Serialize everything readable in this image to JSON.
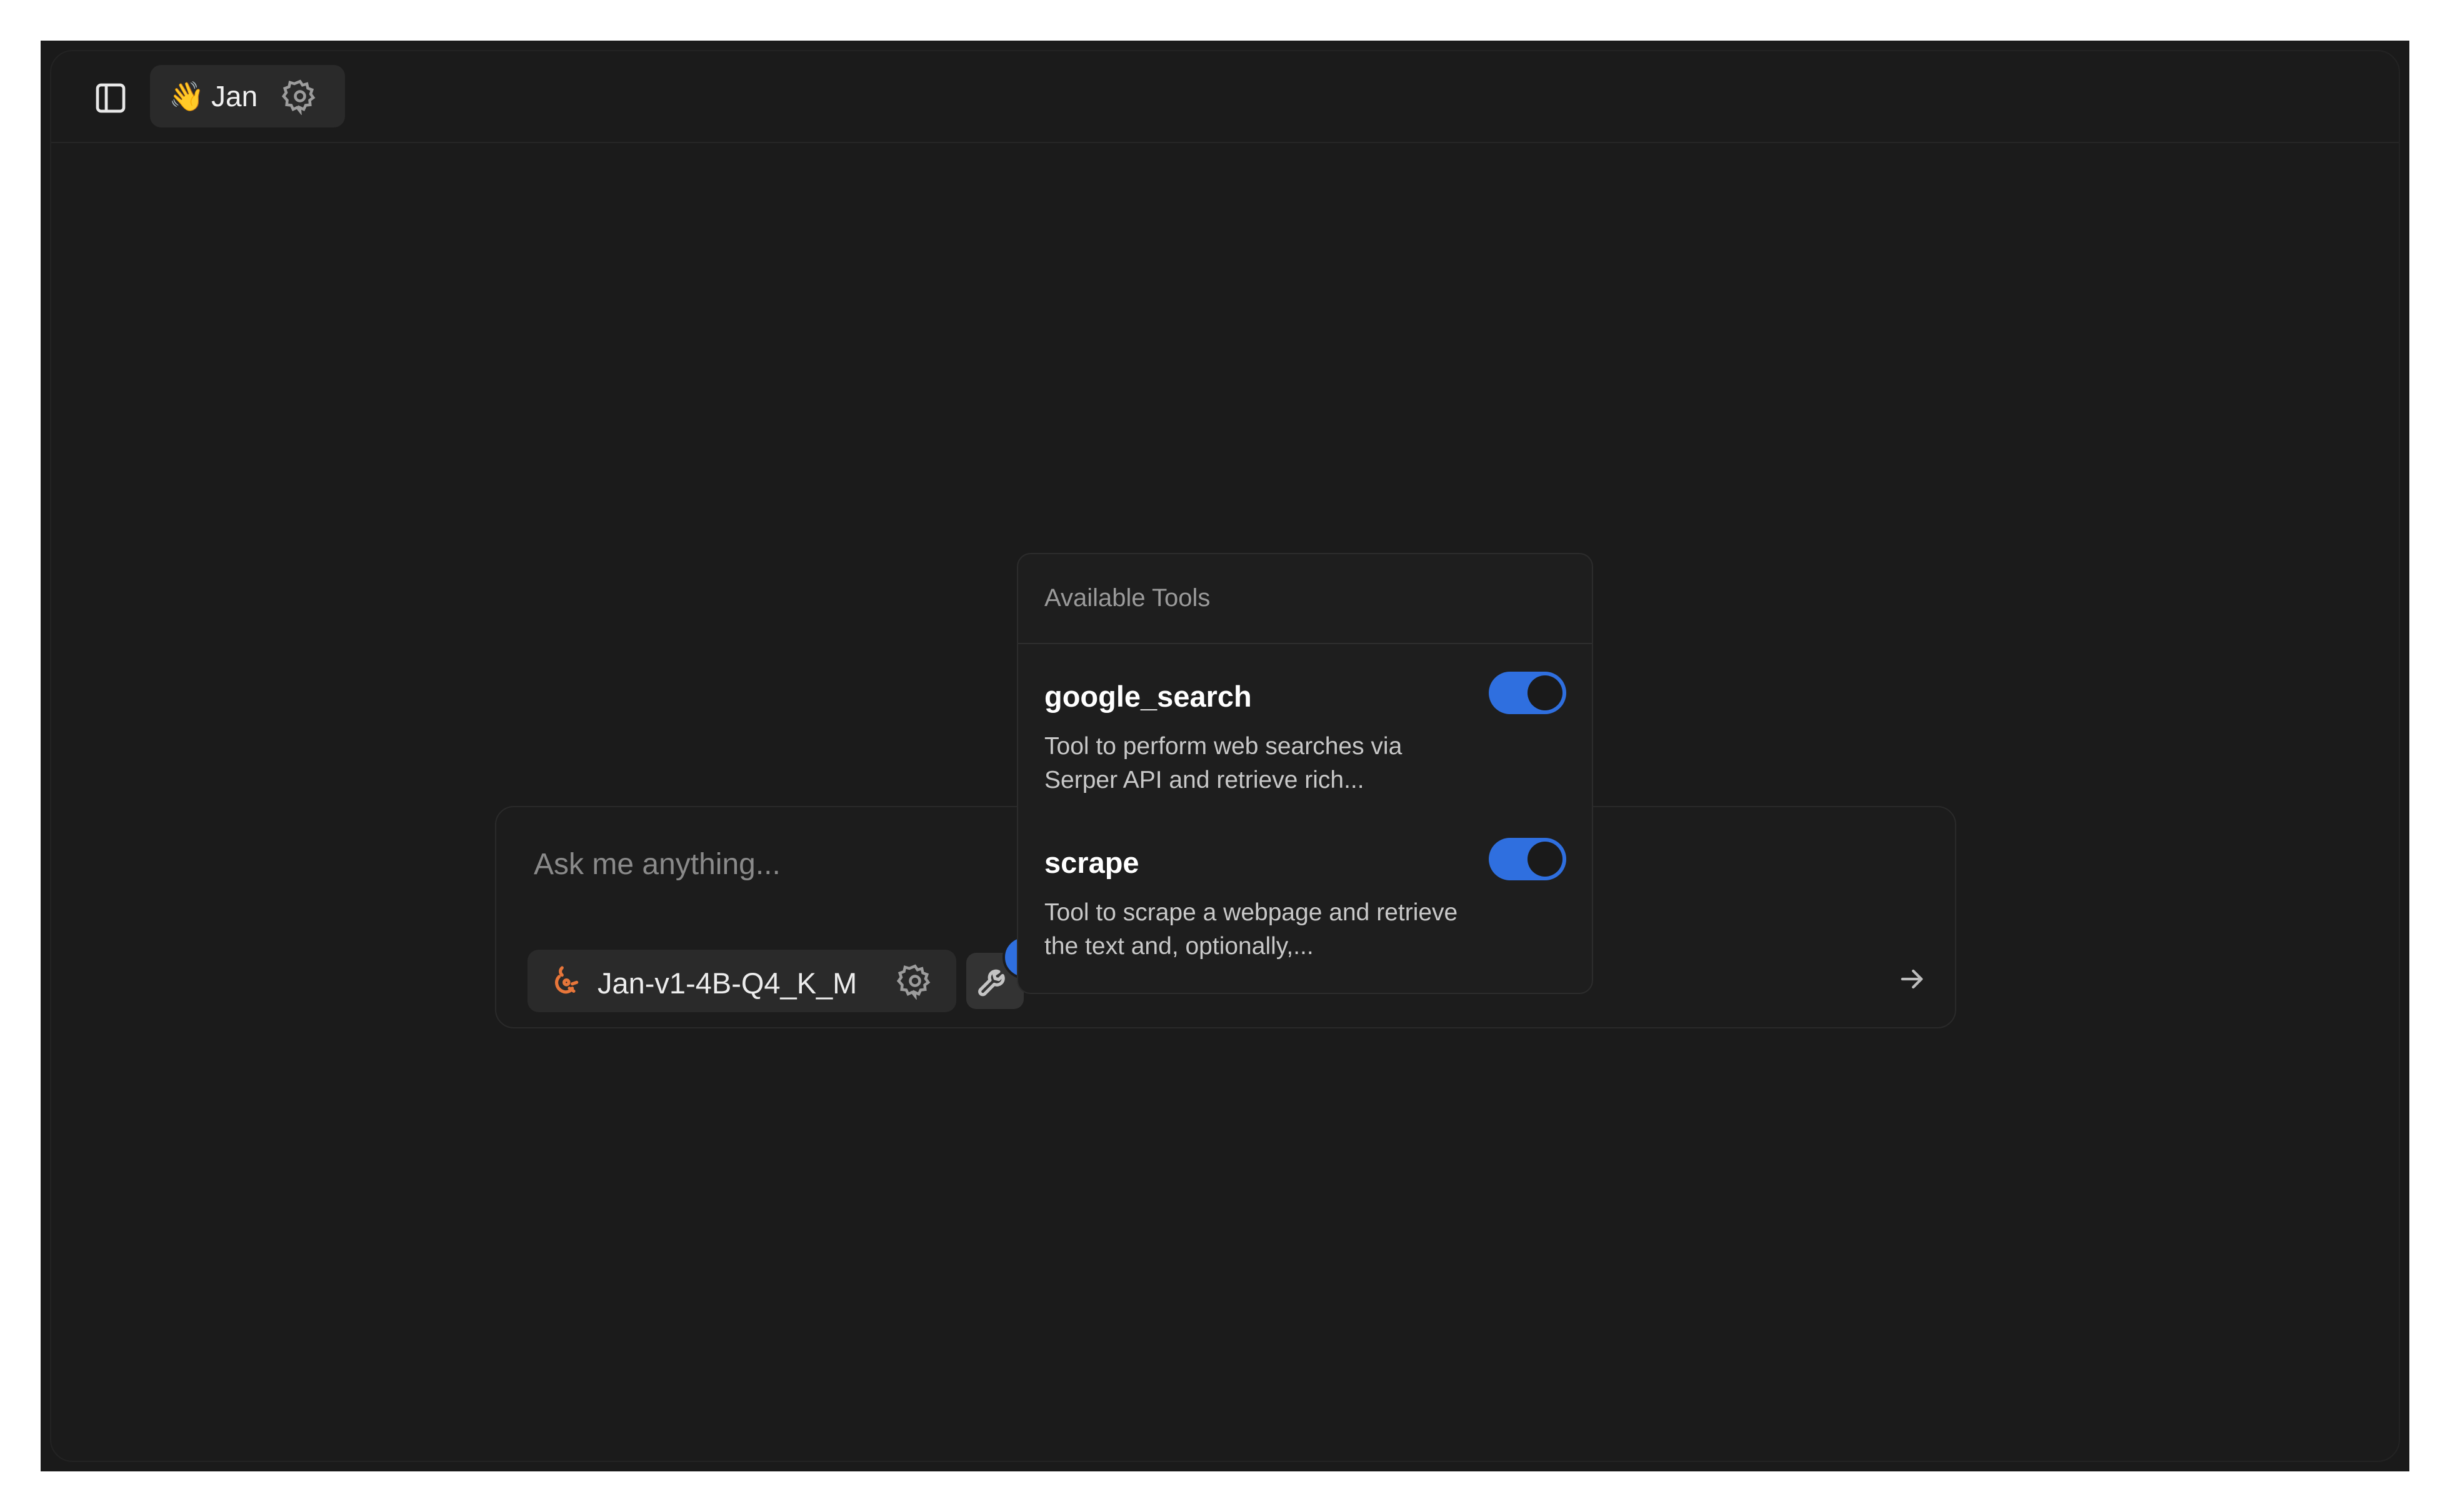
{
  "header": {
    "assistant": {
      "emoji": "👋",
      "name": "Jan"
    }
  },
  "composer": {
    "placeholder": "Ask me anything...",
    "model": "Jan-v1-4B-Q4_K_M",
    "tools_count": "2"
  },
  "tools_popover": {
    "title": "Available Tools",
    "tools": [
      {
        "name": "google_search",
        "description": "Tool to perform web searches via Serper API and retrieve rich...",
        "enabled": true
      },
      {
        "name": "scrape",
        "description": "Tool to scrape a webpage and retrieve the text and, optionally,...",
        "enabled": true
      }
    ]
  },
  "colors": {
    "background": "#1b1b1b",
    "accent": "#2f6fdf",
    "model_icon": "#e8763a"
  }
}
